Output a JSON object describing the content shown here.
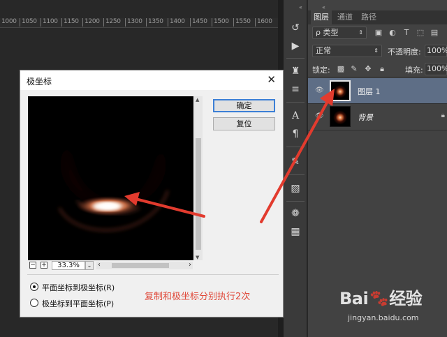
{
  "ruler": {
    "ticks": [
      "1000",
      "1050",
      "1100",
      "1150",
      "1200",
      "1250",
      "1300",
      "1350",
      "1400",
      "1450",
      "1500",
      "1550",
      "1600"
    ]
  },
  "toolbar": {
    "collapse": "«",
    "icons": [
      "history-brush-icon",
      "play-icon",
      "clone-stamp-icon",
      "adjust-icon",
      "type-icon",
      "paragraph-icon",
      "brush-preset-icon",
      "eraser-icon",
      "crop-icon",
      "palette-icon",
      "grid-icon"
    ]
  },
  "layers_panel": {
    "collapse": "«",
    "tabs": [
      "图层",
      "通道",
      "路径"
    ],
    "filter_kind": "ρ 类型",
    "blend_mode": "正常",
    "opacity_label": "不透明度:",
    "opacity_value": "100%",
    "lock_label": "锁定:",
    "fill_label": "填充:",
    "fill_value": "100%",
    "layers": [
      {
        "name": "图层 1",
        "selected": true
      },
      {
        "name": "背景",
        "selected": false,
        "locked": true
      }
    ]
  },
  "dialog": {
    "title": "极坐标",
    "ok_label": "确定",
    "reset_label": "复位",
    "zoom_value": "33.3%",
    "zoom_minus": "−",
    "zoom_plus": "+",
    "options": [
      {
        "label": "平面坐标到极坐标(R)",
        "checked": true
      },
      {
        "label": "极坐标到平面坐标(P)",
        "checked": false
      }
    ]
  },
  "annotation": "复制和极坐标分别执行2次",
  "watermark": {
    "logo": "Bai",
    "logo_tail": "经验",
    "url": "jingyan.baidu.com"
  },
  "colors": {
    "annotation_red": "#e0493a",
    "arrow_red": "#e23b2e",
    "selected_layer": "#5e6e86",
    "default_button_border": "#3c7fd6"
  }
}
